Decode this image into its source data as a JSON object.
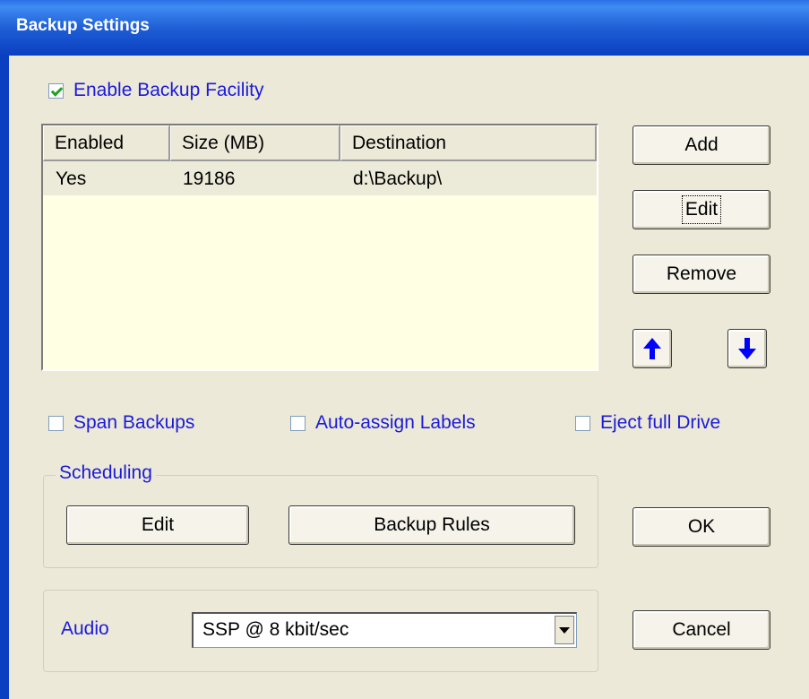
{
  "window": {
    "title": "Backup Settings"
  },
  "enable_backup": {
    "label": "Enable Backup Facility",
    "checked": true
  },
  "backup_list": {
    "columns": [
      "Enabled",
      "Size (MB)",
      "Destination"
    ],
    "rows": [
      {
        "enabled": "Yes",
        "size_mb": "19186",
        "destination": "d:\\Backup\\"
      }
    ]
  },
  "buttons": {
    "add": "Add",
    "edit": "Edit",
    "remove": "Remove",
    "ok": "OK",
    "cancel": "Cancel"
  },
  "move_buttons": {
    "up_icon": "arrow-up-icon",
    "down_icon": "arrow-down-icon",
    "color": "#0000ff"
  },
  "options": {
    "span_backups": {
      "label": "Span Backups",
      "checked": false
    },
    "auto_assign_labels": {
      "label": "Auto-assign Labels",
      "checked": false
    },
    "eject_full_drive": {
      "label": "Eject full Drive",
      "checked": false
    }
  },
  "scheduling": {
    "label": "Scheduling",
    "edit": "Edit",
    "backup_rules": "Backup Rules"
  },
  "audio": {
    "label": "Audio",
    "selected": "SSP @ 8 kbit/sec"
  },
  "colors": {
    "label_text": "#1a1adb",
    "list_bg": "#ffffe4",
    "title_bar": "#0a3fc0"
  }
}
